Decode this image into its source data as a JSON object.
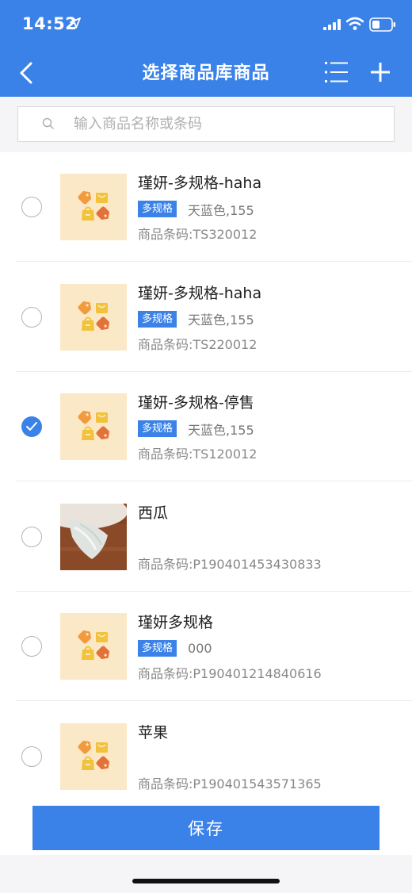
{
  "status_bar": {
    "time": "14:52"
  },
  "nav": {
    "title": "选择商品库商品",
    "icons": [
      "back-arrow-icon",
      "list-icon",
      "plus-icon"
    ]
  },
  "search": {
    "placeholder": "输入商品名称或条码"
  },
  "items": [
    {
      "name": "瑾妍-多规格-haha",
      "tag": "多规格",
      "spec": "天蓝色,155",
      "code": "商品条码:TS320012",
      "checked": false,
      "image": "placeholder"
    },
    {
      "name": "瑾妍-多规格-haha",
      "tag": "多规格",
      "spec": "天蓝色,155",
      "code": "商品条码:TS220012",
      "checked": false,
      "image": "placeholder"
    },
    {
      "name": "瑾妍-多规格-停售",
      "tag": "多规格",
      "spec": "天蓝色,155",
      "code": "商品条码:TS120012",
      "checked": true,
      "image": "placeholder"
    },
    {
      "name": "西瓜",
      "tag": "",
      "spec": "",
      "code": "商品条码:P190401453430833",
      "checked": false,
      "image": "photo"
    },
    {
      "name": "瑾妍多规格",
      "tag": "多规格",
      "spec": "000",
      "code": "商品条码:P190401214840616",
      "checked": false,
      "image": "placeholder"
    },
    {
      "name": "苹果",
      "tag": "",
      "spec": "",
      "code": "商品条码:P190401543571365",
      "checked": false,
      "image": "placeholder"
    }
  ],
  "footer": {
    "save_label": "保存"
  },
  "colors": {
    "primary": "#3b82e8",
    "thumb_bg": "#fbe8c6"
  }
}
